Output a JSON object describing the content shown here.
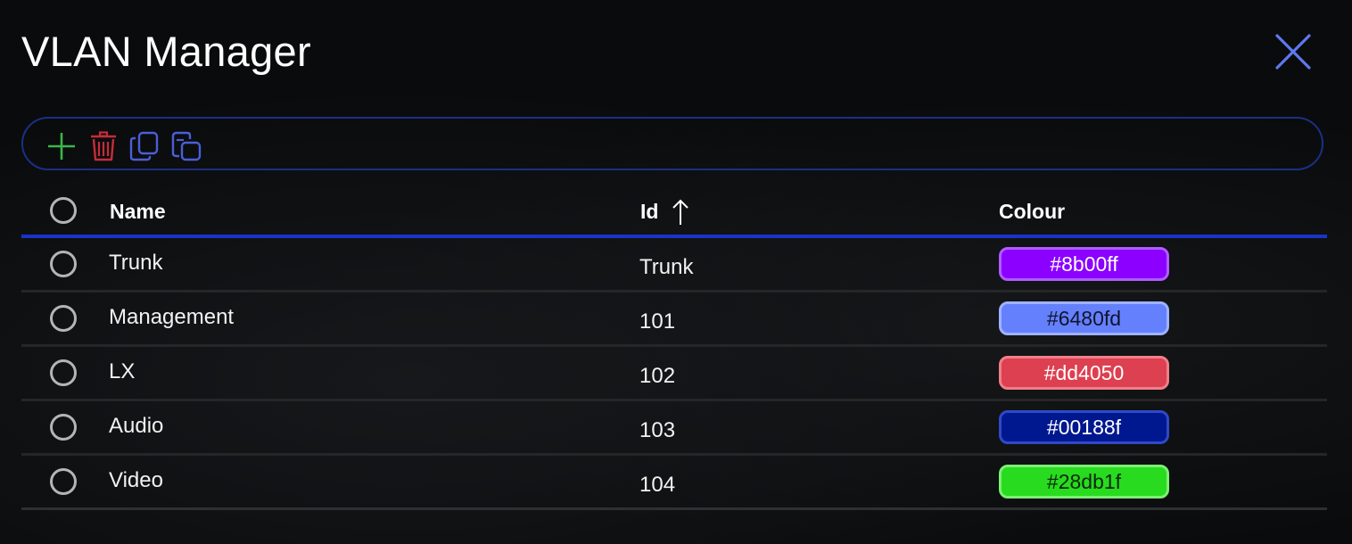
{
  "dialog": {
    "title": "VLAN Manager",
    "close_icon": "close-icon"
  },
  "toolbar": {
    "buttons": [
      {
        "icon": "plus-icon",
        "color": "#3bb54a"
      },
      {
        "icon": "trash-icon",
        "color": "#c62c3a"
      },
      {
        "icon": "copy-icon",
        "color": "#4a5fd8"
      },
      {
        "icon": "paste-icon",
        "color": "#4a5fd8"
      }
    ]
  },
  "table": {
    "headers": {
      "name": "Name",
      "id": "Id",
      "colour": "Colour"
    },
    "sort": {
      "column": "Id",
      "direction": "ascending",
      "icon": "arrow-up-icon"
    },
    "rows": [
      {
        "name": "Trunk",
        "id": "Trunk",
        "colour": "#8b00ff"
      },
      {
        "name": "Management",
        "id": "101",
        "colour": "#6480fd"
      },
      {
        "name": "LX",
        "id": "102",
        "colour": "#dd4050"
      },
      {
        "name": "Audio",
        "id": "103",
        "colour": "#00188f"
      },
      {
        "name": "Video",
        "id": "104",
        "colour": "#28db1f"
      }
    ]
  },
  "colors": {
    "accent": "#1a33c8",
    "toolbar_border": "#1c2f86",
    "close": "#5f78f0"
  }
}
